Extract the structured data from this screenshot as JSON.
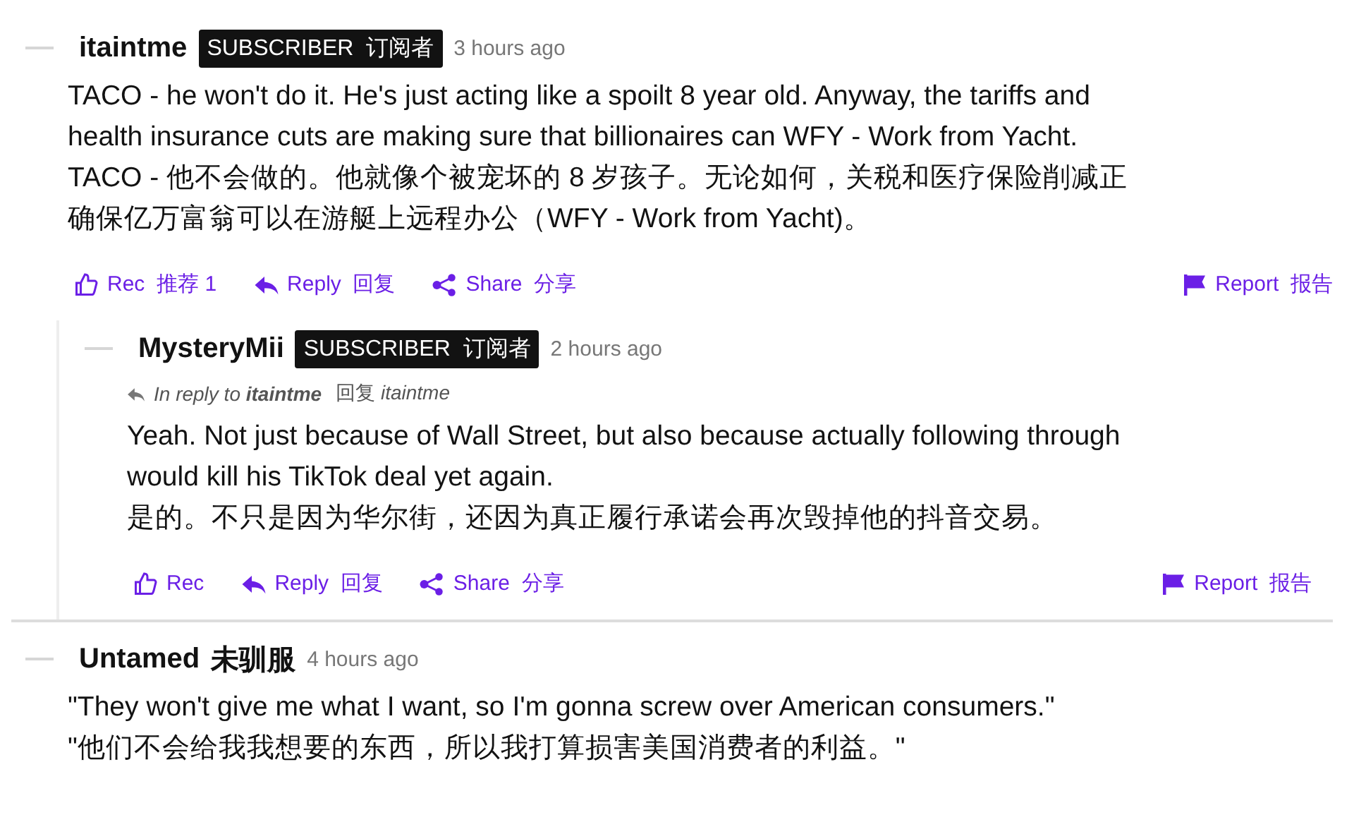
{
  "comments": [
    {
      "author": "itaintme",
      "badge": "SUBSCRIBER  订阅者",
      "time": "3 hours ago",
      "body": [
        "TACO - he won't do it. He's just acting like a spoilt 8 year old. Anyway, the tariffs and",
        "health insurance cuts are making sure that billionaires can WFY - Work from Yacht.",
        "TACO - 他不会做的。他就像个被宠坏的 8 岁孩子。无论如何，关税和医疗保险削减正",
        "确保亿万富翁可以在游艇上远程办公（WFY - Work from Yacht)。"
      ],
      "actions": [
        {
          "kind": "rec",
          "label": "Rec",
          "label_cn": "推荐 1"
        },
        {
          "kind": "reply",
          "label": "Reply",
          "label_cn": "回复"
        },
        {
          "kind": "share",
          "label": "Share",
          "label_cn": "分享"
        }
      ],
      "report": {
        "label": "Report",
        "label_cn": "报告"
      },
      "replies": [
        {
          "author": "MysteryMii",
          "badge": "SUBSCRIBER  订阅者",
          "time": "2 hours ago",
          "reply_to": {
            "prefix": "In reply to",
            "user": "itaintme",
            "prefix_cn": "回复",
            "user_cn": "itaintme"
          },
          "body": [
            "Yeah. Not just because of Wall Street, but also because actually following through",
            "would kill his TikTok deal yet again.",
            "是的。不只是因为华尔街，还因为真正履行承诺会再次毁掉他的抖音交易。"
          ],
          "actions": [
            {
              "kind": "rec",
              "label": "Rec"
            },
            {
              "kind": "reply",
              "label": "Reply",
              "label_cn": "回复"
            },
            {
              "kind": "share",
              "label": "Share",
              "label_cn": "分享"
            }
          ],
          "report": {
            "label": "Report",
            "label_cn": "报告"
          }
        }
      ]
    },
    {
      "author": "Untamed",
      "alias": "未驯服",
      "time": "4 hours ago",
      "body": [
        "\"They won't give me what I want, so I'm gonna screw over American consumers.\"",
        "\"他们不会给我我想要的东西，所以我打算损害美国消费者的利益。\""
      ]
    }
  ]
}
